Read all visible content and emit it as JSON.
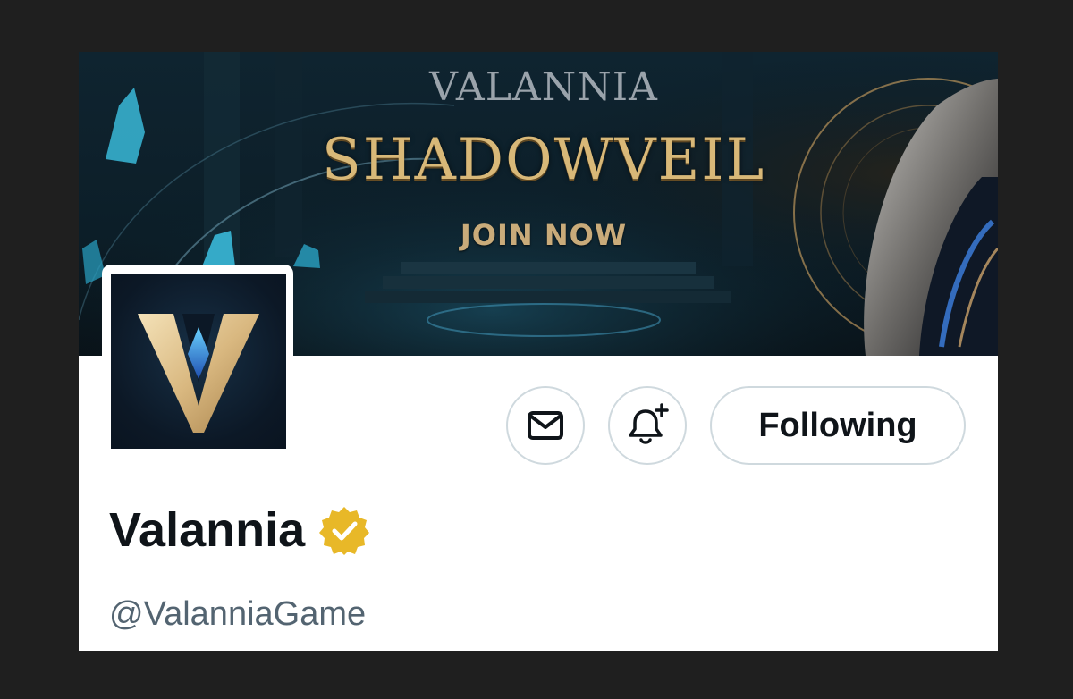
{
  "banner": {
    "brand": "VALANNIA",
    "title": "SHADOWVEIL",
    "cta": "JOIN NOW"
  },
  "profile": {
    "display_name": "Valannia",
    "handle": "@ValanniaGame",
    "verified": true,
    "verified_badge_color": "#e8b828",
    "avatar_icon": "valannia-v-logo"
  },
  "actions": {
    "message_icon": "envelope-icon",
    "notify_icon": "bell-plus-icon",
    "follow_label": "Following"
  },
  "colors": {
    "page_background": "#1f1f1f",
    "text_primary": "#0f1419",
    "text_secondary": "#536471",
    "button_border": "#cfd9de",
    "banner_gold": "#d8b878"
  }
}
